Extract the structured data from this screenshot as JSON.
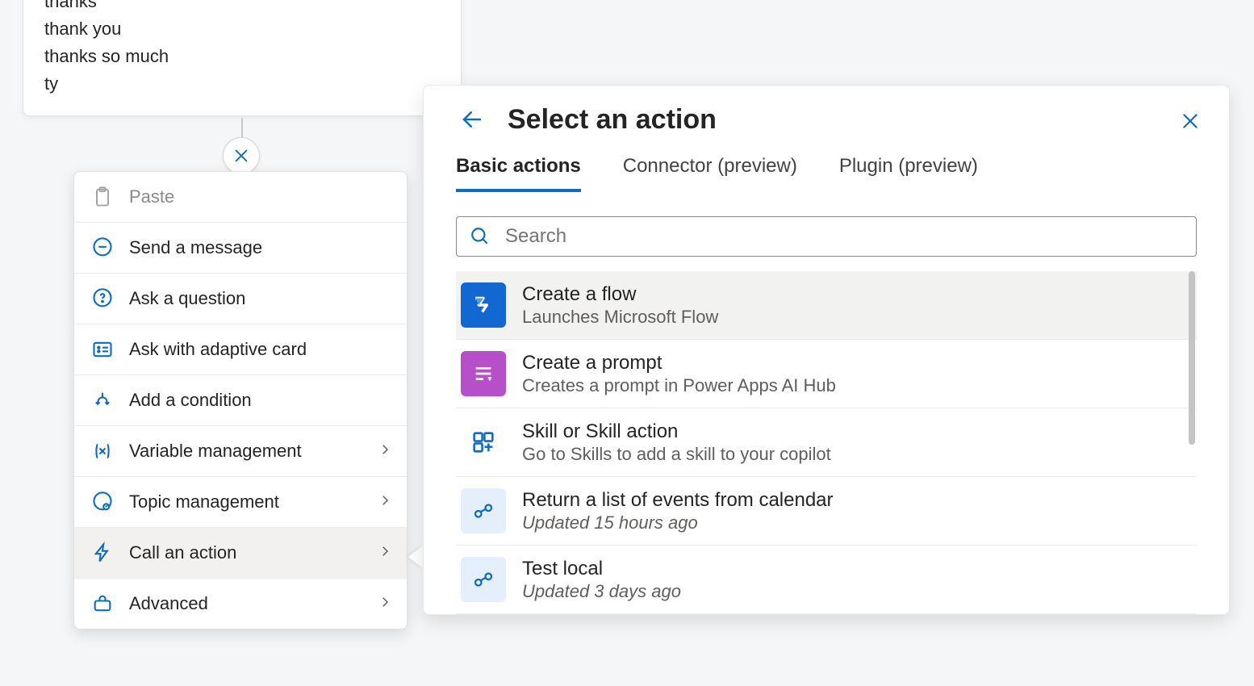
{
  "phrases": [
    "thanks",
    "thank you",
    "thanks so much",
    "ty"
  ],
  "context_menu": {
    "paste": "Paste",
    "send_message": "Send a message",
    "ask_question": "Ask a question",
    "ask_adaptive": "Ask with adaptive card",
    "add_condition": "Add a condition",
    "variable_mgmt": "Variable management",
    "topic_mgmt": "Topic management",
    "call_action": "Call an action",
    "advanced": "Advanced"
  },
  "panel": {
    "title": "Select an action",
    "tabs": {
      "basic": "Basic actions",
      "connector": "Connector (preview)",
      "plugin": "Plugin (preview)"
    },
    "search_placeholder": "Search",
    "actions": [
      {
        "title": "Create a flow",
        "subtitle": "Launches Microsoft Flow",
        "icon": "flow"
      },
      {
        "title": "Create a prompt",
        "subtitle": "Creates a prompt in Power Apps AI Hub",
        "icon": "prompt"
      },
      {
        "title": "Skill or Skill action",
        "subtitle": "Go to Skills to add a skill to your copilot",
        "icon": "skill"
      },
      {
        "title": "Return a list of events from calendar",
        "subtitle": "Updated 15 hours ago",
        "icon": "cloud",
        "italic": true
      },
      {
        "title": "Test local",
        "subtitle": "Updated 3 days ago",
        "icon": "cloud",
        "italic": true
      }
    ]
  }
}
